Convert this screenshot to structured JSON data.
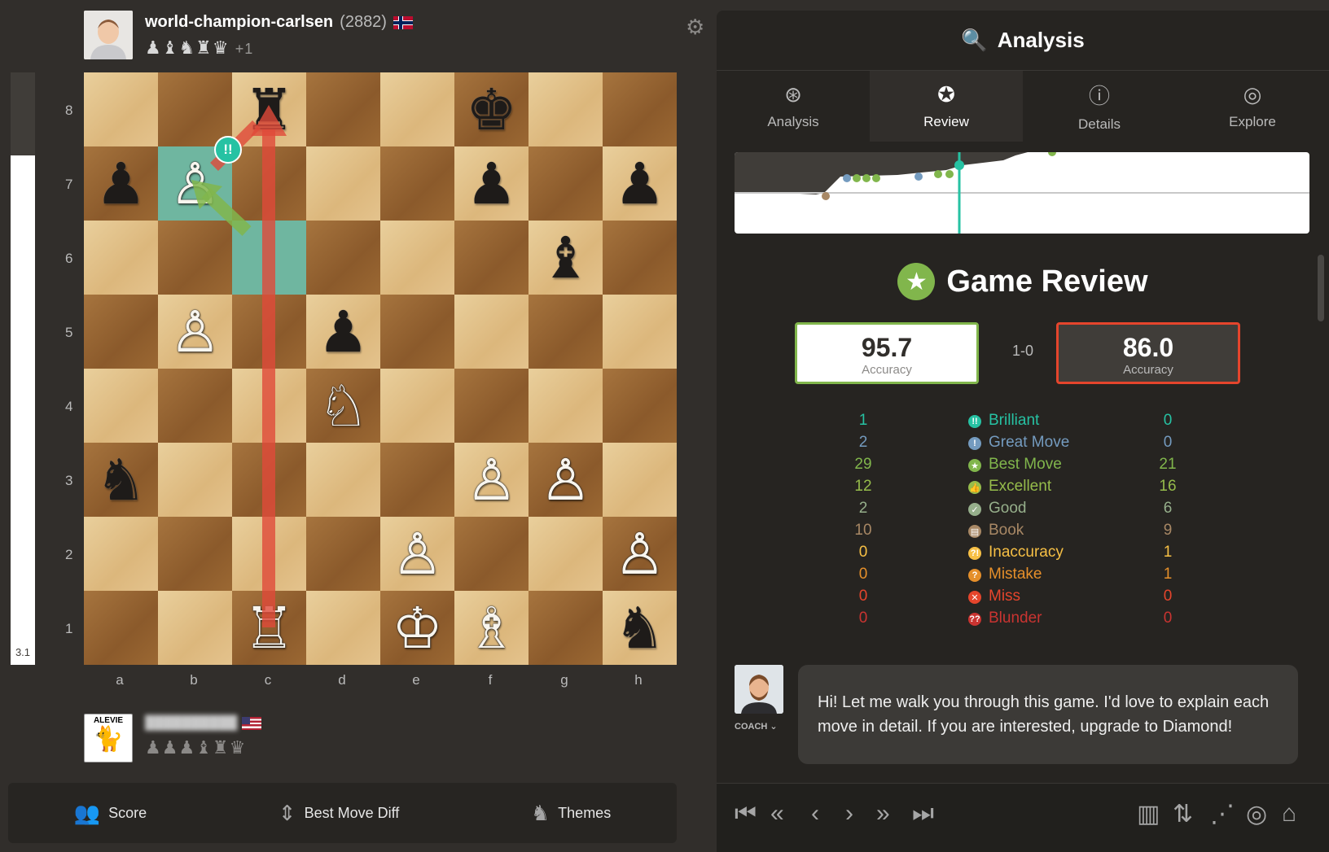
{
  "top_player": {
    "name": "world-champion-carlsen",
    "rating": "(2882)",
    "flag": "🇳🇴",
    "captured": "♟♝♞♜♛",
    "advantage": "+1"
  },
  "bottom_player": {
    "name": "██████████",
    "flag": "🇺🇸",
    "captured": "♟♟♟♝♜♛",
    "avatar_text": "ALEVIE"
  },
  "eval_bar": {
    "value": "3.1",
    "white_fraction": 0.86
  },
  "board": {
    "ranks": [
      "8",
      "7",
      "6",
      "5",
      "4",
      "3",
      "2",
      "1"
    ],
    "files": [
      "a",
      "b",
      "c",
      "d",
      "e",
      "f",
      "g",
      "h"
    ],
    "rows": [
      [
        "",
        "",
        "♜",
        "",
        "",
        "♚",
        "",
        ""
      ],
      [
        "♟",
        "♙",
        "",
        "",
        "",
        "♟",
        "",
        "♟"
      ],
      [
        "",
        "",
        "",
        "",
        "",
        "",
        "♝",
        ""
      ],
      [
        "",
        "♙",
        "",
        "♟",
        "",
        "",
        "",
        ""
      ],
      [
        "",
        "",
        "",
        "♘",
        "",
        "",
        "",
        ""
      ],
      [
        "♞",
        "",
        "",
        "",
        "",
        "♙",
        "♙",
        ""
      ],
      [
        "",
        "",
        "",
        "",
        "♙",
        "",
        "",
        "♙"
      ],
      [
        "",
        "",
        "♖",
        "",
        "♔",
        "♗",
        "",
        "♞"
      ]
    ],
    "brilliant_badge": "!!",
    "colors": {
      "highlight": "#6fb6a0",
      "arrow_best": "#e04a3a",
      "arrow_played": "#81b64c"
    }
  },
  "bottom_bar": {
    "score": "Score",
    "best_move_diff": "Best Move Diff",
    "themes": "Themes"
  },
  "panel": {
    "title": "Analysis",
    "tabs": [
      {
        "label": "Analysis",
        "icon": "search-icon"
      },
      {
        "label": "Review",
        "icon": "star-icon"
      },
      {
        "label": "Details",
        "icon": "info-icon"
      },
      {
        "label": "Explore",
        "icon": "compass-icon"
      }
    ],
    "review_title": "Game Review",
    "white_accuracy": "95.7",
    "black_accuracy": "86.0",
    "accuracy_label": "Accuracy",
    "result": "1-0",
    "stats": [
      {
        "label": "Brilliant",
        "white": "1",
        "black": "0",
        "color": "#26c2a3",
        "icon": "!!"
      },
      {
        "label": "Great Move",
        "white": "2",
        "black": "0",
        "color": "#749bbf",
        "icon": "!"
      },
      {
        "label": "Best Move",
        "white": "29",
        "black": "21",
        "color": "#81b64c",
        "icon": "★"
      },
      {
        "label": "Excellent",
        "white": "12",
        "black": "16",
        "color": "#96bc4b",
        "icon": "👍"
      },
      {
        "label": "Good",
        "white": "2",
        "black": "6",
        "color": "#96af8b",
        "icon": "✓"
      },
      {
        "label": "Book",
        "white": "10",
        "black": "9",
        "color": "#a88865",
        "icon": "▤"
      },
      {
        "label": "Inaccuracy",
        "white": "0",
        "black": "1",
        "color": "#f7c045",
        "icon": "?!"
      },
      {
        "label": "Mistake",
        "white": "0",
        "black": "1",
        "color": "#e58f2a",
        "icon": "?"
      },
      {
        "label": "Miss",
        "white": "0",
        "black": "0",
        "color": "#e5452c",
        "icon": "✕"
      },
      {
        "label": "Blunder",
        "white": "0",
        "black": "0",
        "color": "#ca3431",
        "icon": "??"
      }
    ],
    "coach_label": "COACH",
    "coach_message": "Hi! Let me walk you through this game. I'd love to explain each move in detail. If you are interested, upgrade to Diamond!"
  },
  "nav": {
    "icons": [
      "first-move-icon",
      "back-fast-icon",
      "prev-icon",
      "next-icon",
      "forward-fast-icon",
      "last-move-icon",
      "chart-icon",
      "flip-icon",
      "share-icon",
      "target-icon",
      "library-icon"
    ]
  }
}
